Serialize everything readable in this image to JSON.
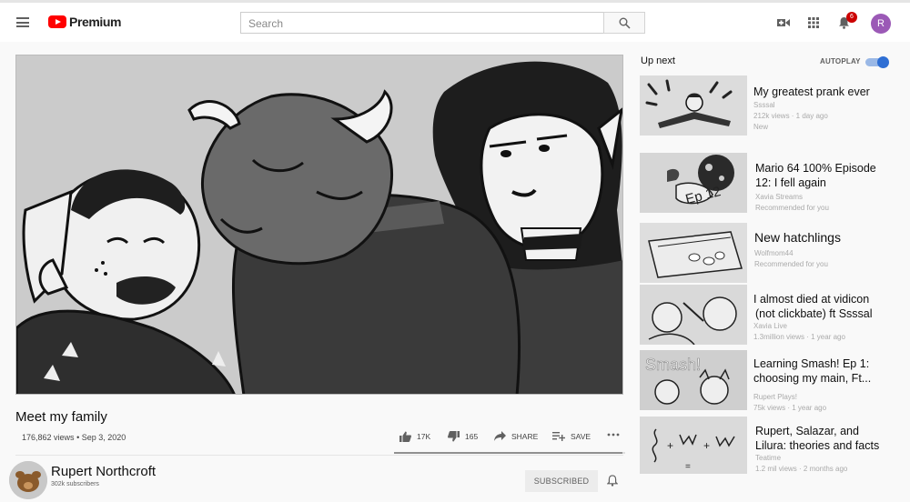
{
  "header": {
    "brand": "Premium",
    "search_placeholder": "Search",
    "notification_count": "6",
    "account_initial": "R"
  },
  "video": {
    "title": "Meet my family",
    "views": "176,862 views",
    "date": "Sep 3, 2020",
    "likes": "17K",
    "dislikes": "165",
    "share_label": "SHARE",
    "save_label": "SAVE",
    "like_ratio": 0.99
  },
  "channel": {
    "name": "Rupert Northcroft",
    "subscribers": "302k subscribers",
    "subscribe_state": "SUBSCRIBED"
  },
  "sidebar": {
    "up_next": "Up next",
    "autoplay": "AUTOPLAY",
    "items": [
      {
        "title1": "My greatest prank ever",
        "title2": "",
        "channel": "Ssssal",
        "views": "212k views · 1 day ago",
        "extra": "New"
      },
      {
        "title1": "Mario 64 100% Episode",
        "title2": "12: I fell again",
        "channel": "Xavia Streams",
        "views": "Recommended for you",
        "extra": ""
      },
      {
        "title1": "New hatchlings",
        "title2": "",
        "channel": "Wolfmom44",
        "views": "Recommended for you",
        "extra": ""
      },
      {
        "title1": "I almost died at vidicon",
        "title2": "(not clickbate) ft Ssssal",
        "channel": "Xavia Live",
        "views": "1.3million views · 1 year ago",
        "extra": ""
      },
      {
        "title1": "Learning Smash! Ep 1:",
        "title2": "choosing my main, Ft...",
        "channel": "Rupert Plays!",
        "views": "75k views · 1 year ago",
        "extra": ""
      },
      {
        "title1": "Rupert, Salazar, and",
        "title2": "Lilura: theories and facts",
        "channel": "Teatime",
        "views": "1.2 mil views · 2 months ago",
        "extra": ""
      }
    ],
    "thumb_texts": {
      "ep": "Ep 12",
      "smash": "Smash!"
    }
  },
  "colors": {
    "brand_red": "#ff0000",
    "avatar_purple": "#9b59b6",
    "toggle_blue": "#2f6fd4"
  }
}
